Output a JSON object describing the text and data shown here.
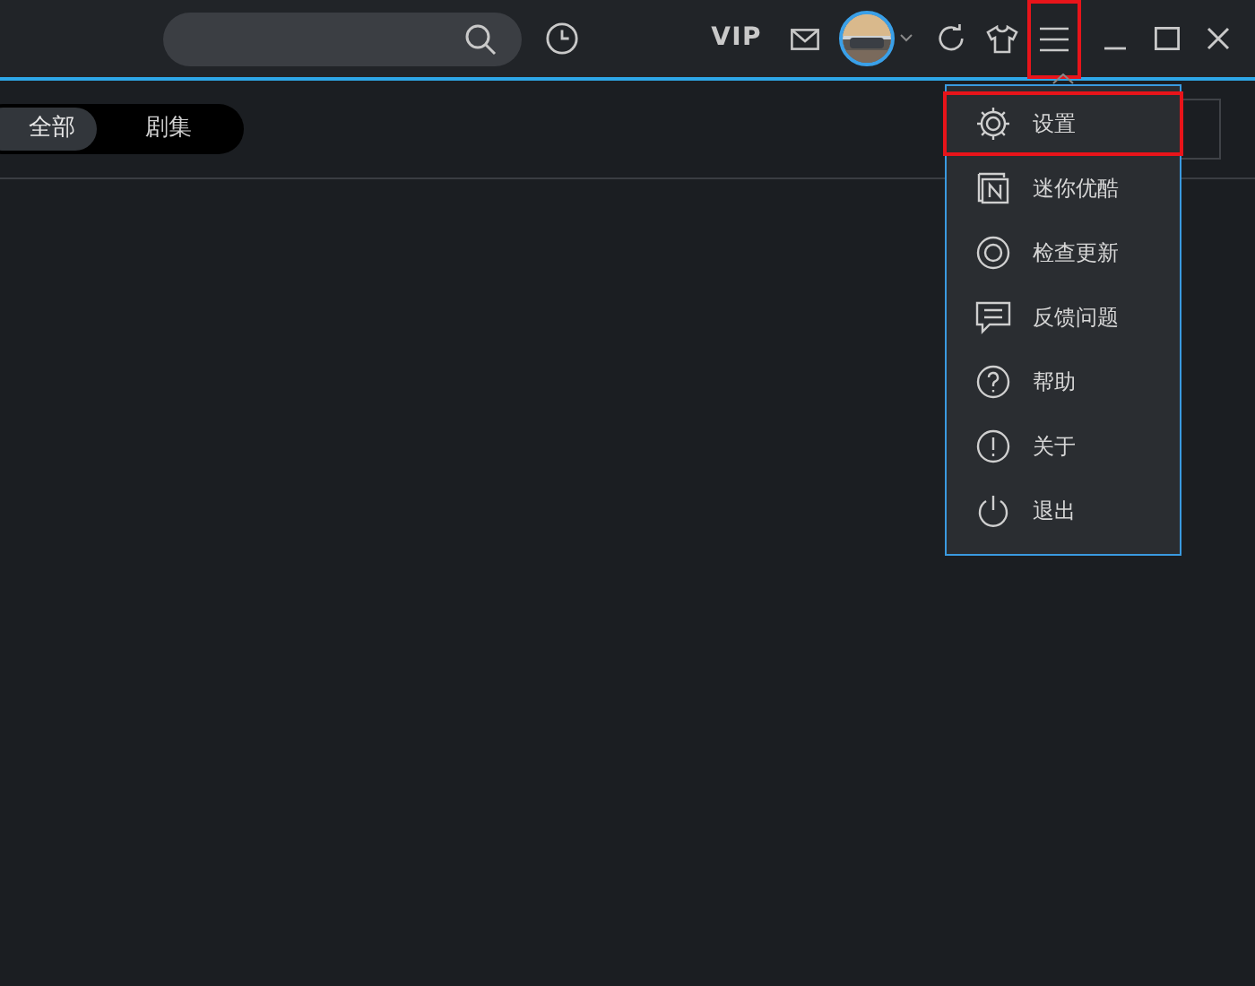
{
  "top_bar": {
    "vip_label": "VIP",
    "menu_button": {
      "highlighted": true
    }
  },
  "tabs": [
    {
      "label": "全部",
      "selected": true
    },
    {
      "label": "剧集",
      "selected": false
    }
  ],
  "menu": {
    "items": [
      {
        "kind": "settings",
        "label": "设置",
        "highlighted": true
      },
      {
        "kind": "mini",
        "label": "迷你优酷",
        "highlighted": false
      },
      {
        "kind": "update",
        "label": "检查更新",
        "highlighted": false
      },
      {
        "kind": "feedback",
        "label": "反馈问题",
        "highlighted": false
      },
      {
        "kind": "help",
        "label": "帮助",
        "highlighted": false
      },
      {
        "kind": "about",
        "label": "关于",
        "highlighted": false
      },
      {
        "kind": "exit",
        "label": "退出",
        "highlighted": false
      }
    ]
  }
}
